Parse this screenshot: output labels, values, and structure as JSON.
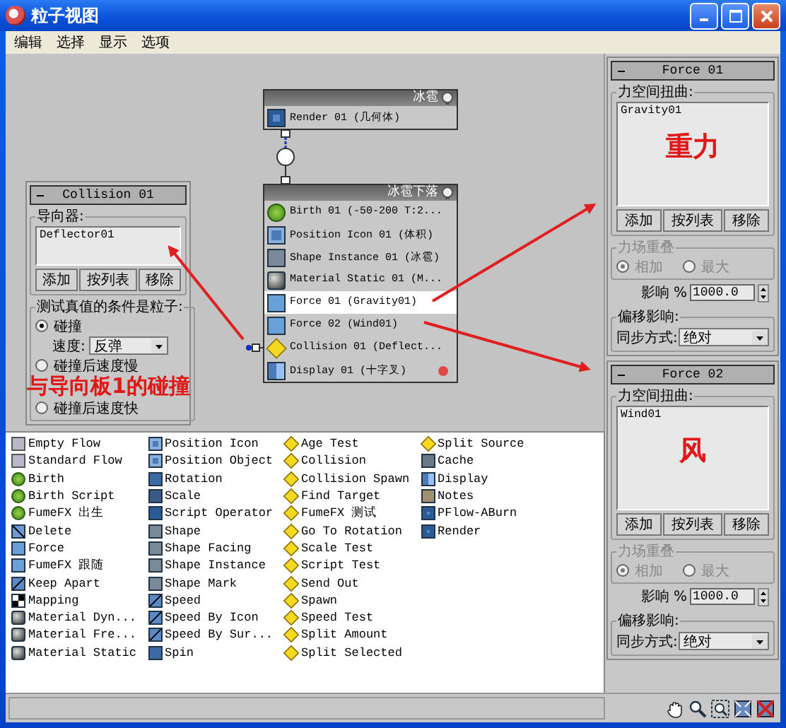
{
  "window": {
    "title": "粒子视图"
  },
  "menu": [
    "编辑",
    "选择",
    "显示",
    "选项"
  ],
  "events": [
    {
      "title": "冰雹",
      "operators": [
        {
          "kind": "render",
          "label": "Render 01 (几何体)",
          "selected": false
        }
      ]
    },
    {
      "title": "冰雹下落",
      "operators": [
        {
          "kind": "birth",
          "label": "Birth 01 (-50-200 T:2...",
          "selected": false
        },
        {
          "kind": "position",
          "label": "Position Icon 01 (体积)",
          "selected": false
        },
        {
          "kind": "shape",
          "label": "Shape Instance 01 (冰雹)",
          "selected": false
        },
        {
          "kind": "material",
          "label": "Material Static 01 (M...",
          "selected": false
        },
        {
          "kind": "force",
          "label": "Force 01 (Gravity01)",
          "selected": true
        },
        {
          "kind": "force",
          "label": "Force 02 (Wind01)",
          "selected": false
        },
        {
          "kind": "test",
          "label": "Collision 01 (Deflect...",
          "selected": false
        },
        {
          "kind": "display",
          "label": "Display 01 (十字叉)",
          "selected": false
        }
      ]
    }
  ],
  "collision_panel": {
    "title": "Collision 01",
    "list_label": "导向器:",
    "items": [
      "Deflector01"
    ],
    "buttons": [
      "添加",
      "按列表",
      "移除"
    ],
    "group_label": "测试真值的条件是粒子:",
    "annotation": "与导向板1的碰撞",
    "options": [
      {
        "label": "碰撞",
        "selected": true
      },
      {
        "label": "碰撞后速度慢",
        "selected": false
      },
      {
        "label": "碰撞后速度快",
        "selected": false
      }
    ],
    "speed_label": "速度:",
    "speed_value": "反弹"
  },
  "force_panels": [
    {
      "title": "Force 01",
      "list_label": "力空间扭曲:",
      "items": [
        "Gravity01"
      ],
      "annotation": "重力",
      "buttons": [
        "添加",
        "按列表",
        "移除"
      ],
      "overlap_label": "力场重叠",
      "overlap_disabled": true,
      "overlap_options": [
        {
          "label": "相加",
          "selected": true
        },
        {
          "label": "最大",
          "selected": false
        }
      ],
      "influence_label": "影响 %",
      "influence_value": "1000.0",
      "offset_label": "偏移影响:",
      "sync_label": "同步方式:",
      "sync_value": "绝对"
    },
    {
      "title": "Force 02",
      "list_label": "力空间扭曲:",
      "items": [
        "Wind01"
      ],
      "annotation": "风",
      "buttons": [
        "添加",
        "按列表",
        "移除"
      ],
      "overlap_label": "力场重叠",
      "overlap_disabled": true,
      "overlap_options": [
        {
          "label": "相加",
          "selected": true
        },
        {
          "label": "最大",
          "selected": false
        }
      ],
      "influence_label": "影响 %",
      "influence_value": "1000.0",
      "offset_label": "偏移影响:",
      "sync_label": "同步方式:",
      "sync_value": "绝对"
    }
  ],
  "depot": {
    "columns": [
      [
        {
          "kind": "flow",
          "label": "Empty Flow"
        },
        {
          "kind": "flow",
          "label": "Standard Flow"
        },
        {
          "kind": "birth",
          "label": "Birth"
        },
        {
          "kind": "birth",
          "label": "Birth Script"
        },
        {
          "kind": "birth",
          "label": "FumeFX 出生"
        },
        {
          "kind": "delete",
          "label": "Delete"
        },
        {
          "kind": "force",
          "label": "Force"
        },
        {
          "kind": "force",
          "label": "FumeFX 跟随"
        },
        {
          "kind": "speed",
          "label": "Keep Apart"
        },
        {
          "kind": "mapping",
          "label": "Mapping"
        },
        {
          "kind": "material",
          "label": "Material Dyn..."
        },
        {
          "kind": "material",
          "label": "Material Fre..."
        },
        {
          "kind": "material",
          "label": "Material Static"
        }
      ],
      [
        {
          "kind": "position",
          "label": "Position Icon"
        },
        {
          "kind": "position",
          "label": "Position Object"
        },
        {
          "kind": "rotation",
          "label": "Rotation"
        },
        {
          "kind": "scale",
          "label": "Scale"
        },
        {
          "kind": "script",
          "label": "Script Operator"
        },
        {
          "kind": "shape",
          "label": "Shape"
        },
        {
          "kind": "shape",
          "label": "Shape Facing"
        },
        {
          "kind": "shape",
          "label": "Shape Instance"
        },
        {
          "kind": "shape",
          "label": "Shape Mark"
        },
        {
          "kind": "speed",
          "label": "Speed"
        },
        {
          "kind": "speed",
          "label": "Speed By Icon"
        },
        {
          "kind": "speed",
          "label": "Speed By Sur..."
        },
        {
          "kind": "rotation",
          "label": "Spin"
        }
      ],
      [
        {
          "kind": "test",
          "label": "Age Test"
        },
        {
          "kind": "test",
          "label": "Collision"
        },
        {
          "kind": "test",
          "label": "Collision Spawn"
        },
        {
          "kind": "test",
          "label": "Find Target"
        },
        {
          "kind": "test",
          "label": "FumeFX 测试"
        },
        {
          "kind": "test",
          "label": "Go To Rotation"
        },
        {
          "kind": "test",
          "label": "Scale Test"
        },
        {
          "kind": "test",
          "label": "Script Test"
        },
        {
          "kind": "test",
          "label": "Send Out"
        },
        {
          "kind": "test",
          "label": "Spawn"
        },
        {
          "kind": "test",
          "label": "Speed Test"
        },
        {
          "kind": "test",
          "label": "Split Amount"
        },
        {
          "kind": "test",
          "label": "Split Selected"
        }
      ],
      [
        {
          "kind": "test",
          "label": "Split Source"
        },
        {
          "kind": "cache",
          "label": "Cache"
        },
        {
          "kind": "display",
          "label": "Display"
        },
        {
          "kind": "notes",
          "label": "Notes"
        },
        {
          "kind": "render",
          "label": "PFlow-ABurn"
        },
        {
          "kind": "render",
          "label": "Render"
        }
      ]
    ]
  }
}
